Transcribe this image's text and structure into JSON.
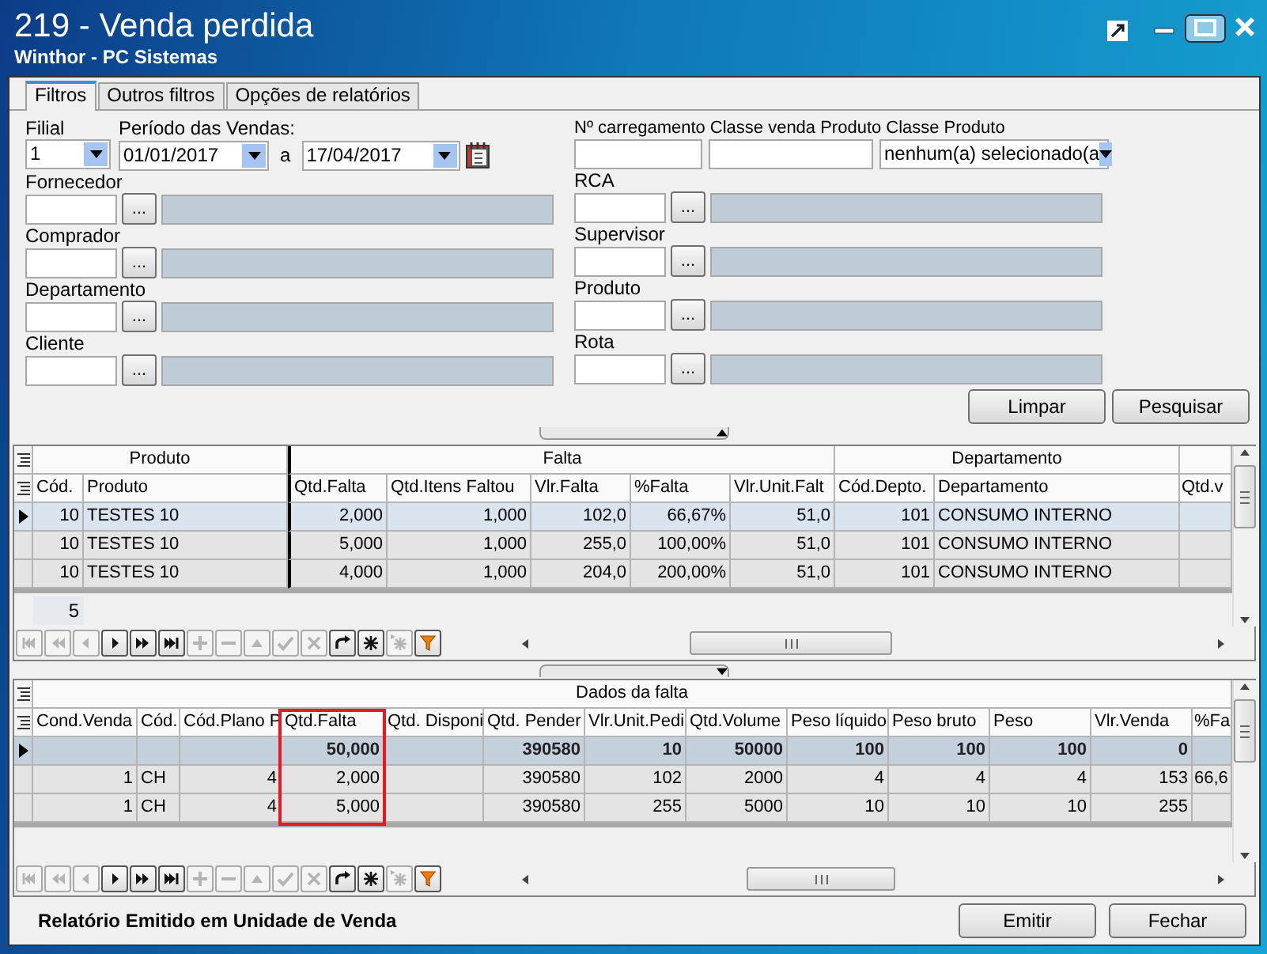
{
  "window": {
    "title": "219 - Venda perdida",
    "subtitle": "Winthor - PC Sistemas"
  },
  "tabs": [
    {
      "label": "Filtros",
      "selected": true
    },
    {
      "label": "Outros filtros",
      "selected": false
    },
    {
      "label": "Opções de relatórios",
      "selected": false
    }
  ],
  "filters": {
    "filial": {
      "label": "Filial",
      "value": "1"
    },
    "period": {
      "label": "Período das Vendas:",
      "start": "01/01/2017",
      "separator": "a",
      "end": "17/04/2017"
    },
    "top_right": [
      {
        "label": "Nº carregamento",
        "kind": "text"
      },
      {
        "label": "Classe venda Produto",
        "kind": "text"
      },
      {
        "label": "Classe Produto",
        "kind": "combo",
        "value": "nenhum(a) selecionado(a"
      }
    ],
    "lookups_left": [
      {
        "label": "Fornecedor",
        "button": "..."
      },
      {
        "label": "Comprador",
        "button": "..."
      },
      {
        "label": "Departamento",
        "button": "..."
      },
      {
        "label": "Cliente",
        "button": "..."
      }
    ],
    "lookups_right": [
      {
        "label": "RCA",
        "button": "..."
      },
      {
        "label": "Supervisor",
        "button": "..."
      },
      {
        "label": "Produto",
        "button": "..."
      },
      {
        "label": "Rota",
        "button": "..."
      }
    ]
  },
  "actions": [
    "Limpar",
    "Pesquisar"
  ],
  "grid_products": {
    "bands": [
      {
        "label": "Produto",
        "columns": [
          {
            "label": "Cód.",
            "kind": "number"
          },
          {
            "label": "Produto",
            "kind": "text"
          }
        ]
      },
      {
        "label": "Falta",
        "columns": [
          {
            "label": "Qtd.Falta",
            "kind": "number"
          },
          {
            "label": "Qtd.Itens Faltou",
            "kind": "number"
          },
          {
            "label": "Vlr.Falta",
            "kind": "number"
          },
          {
            "label": "%Falta",
            "kind": "number"
          },
          {
            "label": "Vlr.Unit.Falt",
            "kind": "number"
          }
        ]
      },
      {
        "label": "Departamento",
        "columns": [
          {
            "label": "Cód.Depto.",
            "kind": "number"
          },
          {
            "label": "Departamento",
            "kind": "text"
          }
        ]
      },
      {
        "columns": [
          {
            "label": "Qtd.v",
            "kind": "number"
          }
        ]
      }
    ],
    "rows": [
      {
        "selected": true,
        "cells": [
          "10",
          "TESTES 10",
          "2,000",
          "1,000",
          "102,0",
          "66,67%",
          "51,0",
          "101",
          "CONSUMO INTERNO"
        ]
      },
      {
        "selected": false,
        "cells": [
          "10",
          "TESTES 10",
          "5,000",
          "1,000",
          "255,0",
          "100,00%",
          "51,0",
          "101",
          "CONSUMO INTERNO"
        ]
      },
      {
        "selected": false,
        "cells": [
          "10",
          "TESTES 10",
          "4,000",
          "1,000",
          "204,0",
          "200,00%",
          "51,0",
          "101",
          "CONSUMO INTERNO"
        ]
      }
    ],
    "record_count": "5",
    "navigator": [
      {
        "kind": "first",
        "disabled": true
      },
      {
        "kind": "prior-page",
        "disabled": true
      },
      {
        "kind": "prior",
        "disabled": true
      },
      {
        "kind": "next",
        "disabled": false
      },
      {
        "kind": "next-page",
        "disabled": false
      },
      {
        "kind": "last",
        "disabled": false
      },
      {
        "kind": "insert",
        "disabled": true
      },
      {
        "kind": "delete",
        "disabled": true
      },
      {
        "kind": "edit",
        "disabled": true
      },
      {
        "kind": "post",
        "disabled": true
      },
      {
        "kind": "cancel",
        "disabled": true
      },
      {
        "kind": "refresh",
        "disabled": false
      },
      {
        "kind": "bookmark",
        "disabled": false
      },
      {
        "kind": "goto-bookmark",
        "disabled": true
      },
      {
        "kind": "filter",
        "disabled": false
      }
    ]
  },
  "grid_details": {
    "band": "Dados da falta",
    "columns": [
      {
        "label": "Cond.Venda",
        "kind": "number",
        "highlighted": false
      },
      {
        "label": "Cód.",
        "kind": "text",
        "highlighted": false
      },
      {
        "label": "Cód.Plano P",
        "kind": "number",
        "highlighted": false
      },
      {
        "label": "Qtd.Falta",
        "kind": "number",
        "highlighted": true
      },
      {
        "label": "Qtd. Disponi",
        "kind": "number",
        "highlighted": false
      },
      {
        "label": "Qtd. Pender",
        "kind": "number",
        "highlighted": false
      },
      {
        "label": "Vlr.Unit.Pedi",
        "kind": "number",
        "highlighted": false
      },
      {
        "label": "Qtd.Volume",
        "kind": "number",
        "highlighted": false
      },
      {
        "label": "Peso líquido",
        "kind": "number",
        "highlighted": false
      },
      {
        "label": "Peso bruto",
        "kind": "number",
        "highlighted": false
      },
      {
        "label": "Peso",
        "kind": "number",
        "highlighted": false
      },
      {
        "label": "Vlr.Venda",
        "kind": "number",
        "highlighted": false
      },
      {
        "label": "%Fa",
        "kind": "text",
        "highlighted": false
      }
    ],
    "rows": [
      {
        "kind": "total",
        "selected": true,
        "cells": [
          null,
          null,
          null,
          "50,000",
          null,
          "390580",
          "10",
          "50000",
          "100",
          "100",
          "100",
          "0",
          null
        ]
      },
      {
        "kind": "data",
        "selected": false,
        "cells": [
          "1",
          "CH",
          "4",
          "2,000",
          null,
          "390580",
          "102",
          "2000",
          "4",
          "4",
          "4",
          "153",
          "66,6"
        ]
      },
      {
        "kind": "data",
        "selected": false,
        "cells": [
          "1",
          "CH",
          "4",
          "5,000",
          null,
          "390580",
          "255",
          "5000",
          "10",
          "10",
          "10",
          "255",
          null
        ]
      }
    ],
    "navigator": [
      {
        "kind": "first",
        "disabled": true
      },
      {
        "kind": "prior-page",
        "disabled": true
      },
      {
        "kind": "prior",
        "disabled": true
      },
      {
        "kind": "next",
        "disabled": false
      },
      {
        "kind": "next-page",
        "disabled": false
      },
      {
        "kind": "last",
        "disabled": false
      },
      {
        "kind": "insert",
        "disabled": true
      },
      {
        "kind": "delete",
        "disabled": true
      },
      {
        "kind": "edit",
        "disabled": true
      },
      {
        "kind": "post",
        "disabled": true
      },
      {
        "kind": "cancel",
        "disabled": true
      },
      {
        "kind": "refresh",
        "disabled": false
      },
      {
        "kind": "bookmark",
        "disabled": false
      },
      {
        "kind": "goto-bookmark",
        "disabled": true
      },
      {
        "kind": "filter",
        "disabled": false
      }
    ]
  },
  "footer": {
    "note": "Relatório Emitido em Unidade de Venda",
    "buttons": [
      "Emitir",
      "Fechar"
    ]
  }
}
